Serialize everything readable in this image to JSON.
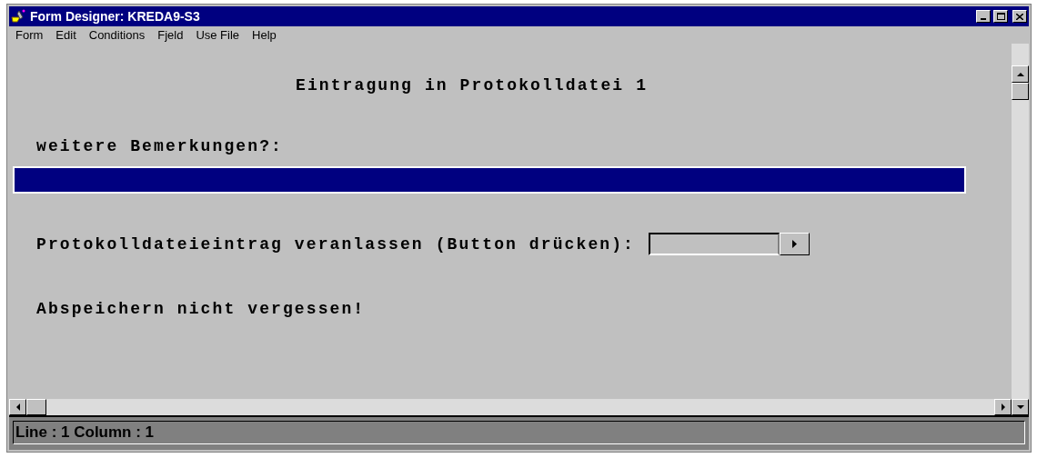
{
  "window": {
    "title": "Form Designer:  KREDA9-S3"
  },
  "menu": [
    "Form",
    "Edit",
    "Conditions",
    "Fjeld",
    "Use File",
    "Help"
  ],
  "form": [
    {
      "kind": "label",
      "text": "Eintragung in Protokolldatei 1"
    },
    {
      "kind": "label",
      "text": "weitere Bemerkungen?:"
    },
    {
      "kind": "text_field",
      "focused": true
    },
    {
      "kind": "label",
      "text": "Protokolldateieintrag veranlassen (Button drücken):"
    },
    {
      "kind": "button_field"
    },
    {
      "kind": "label",
      "text": "Abspeichern nicht vergessen!"
    }
  ],
  "status_bar": "Line : 1  Column : 1"
}
